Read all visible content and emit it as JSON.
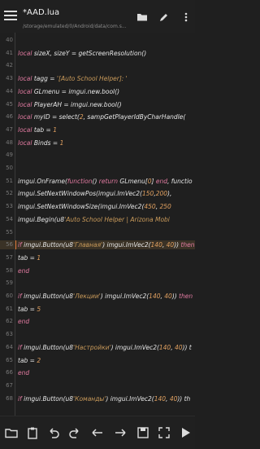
{
  "header": {
    "title": "*AAD.lua",
    "path": "/storage/emulated/0/Android/data/com.s..."
  },
  "toolbar": {
    "icons": [
      "folder-icon",
      "pencil-icon",
      "more-vert-icon"
    ]
  },
  "editor": {
    "lines": [
      {
        "n": "40",
        "t": "",
        "hl": false
      },
      {
        "n": "41",
        "t": "local sizeX, sizeY = getScreenResolution()",
        "hl": false
      },
      {
        "n": "42",
        "t": "",
        "hl": false
      },
      {
        "n": "43",
        "t": "local tagg = '[Auto School Helper]: '",
        "hl": false
      },
      {
        "n": "44",
        "t": "local GLmenu = imgui.new.bool()",
        "hl": false
      },
      {
        "n": "45",
        "t": "local PlayerAH = imgui.new.bool()",
        "hl": false
      },
      {
        "n": "46",
        "t": "local myID = select(2, sampGetPlayerIdByCharHandle(",
        "hl": false
      },
      {
        "n": "47",
        "t": "local tab = 1",
        "hl": false
      },
      {
        "n": "48",
        "t": "local Binds = 1",
        "hl": false
      },
      {
        "n": "49",
        "t": "",
        "hl": false
      },
      {
        "n": "50",
        "t": "",
        "hl": false
      },
      {
        "n": "51",
        "t": "imgui.OnFrame(function() return GLmenu[0] end, functio",
        "hl": false
      },
      {
        "n": "52",
        "t": "      imgui.SetNextWindowPos(imgui.ImVec2(150,200),",
        "hl": false
      },
      {
        "n": "53",
        "t": "    imgui.SetNextWindowSize(imgui.ImVec2(450, 250",
        "hl": false
      },
      {
        "n": "54",
        "t": "    imgui.Begin(u8'Auto School Helper | Arizona Mobi",
        "hl": false
      },
      {
        "n": "55",
        "t": "",
        "hl": false
      },
      {
        "n": "56",
        "t": "if imgui.Button(u8'Главная') imgui.ImVec2(140, 40)) then",
        "hl": true
      },
      {
        "n": "57",
        "t": "    tab = 1",
        "hl": false
      },
      {
        "n": "58",
        "t": "end",
        "hl": false
      },
      {
        "n": "59",
        "t": "",
        "hl": false
      },
      {
        "n": "60",
        "t": "if imgui.Button(u8'Лекции') imgui.ImVec2(140, 40)) then",
        "hl": false
      },
      {
        "n": "61",
        "t": "    tab = 5",
        "hl": false
      },
      {
        "n": "62",
        "t": "end",
        "hl": false
      },
      {
        "n": "63",
        "t": "",
        "hl": false
      },
      {
        "n": "64",
        "t": "if imgui.Button(u8'Настройки') imgui.ImVec2(140, 40)) t",
        "hl": false
      },
      {
        "n": "65",
        "t": "    tab = 2",
        "hl": false
      },
      {
        "n": "66",
        "t": "end",
        "hl": false
      },
      {
        "n": "67",
        "t": "",
        "hl": false
      },
      {
        "n": "68",
        "t": "if imgui.Button(u8'Команды') imgui.ImVec2(140, 40)) th",
        "hl": false
      }
    ]
  },
  "bottombar": {
    "icons": [
      "folder-open-icon",
      "clipboard-icon",
      "undo-icon",
      "redo-icon",
      "arrow-left-icon",
      "arrow-right-icon",
      "save-icon",
      "fullscreen-icon",
      "play-icon"
    ]
  },
  "colors": {
    "background": "#1f1f1f",
    "keyword": "#e07aa0",
    "number": "#e0a060",
    "string": "#c99a5a",
    "highlight": "#3a3226"
  }
}
